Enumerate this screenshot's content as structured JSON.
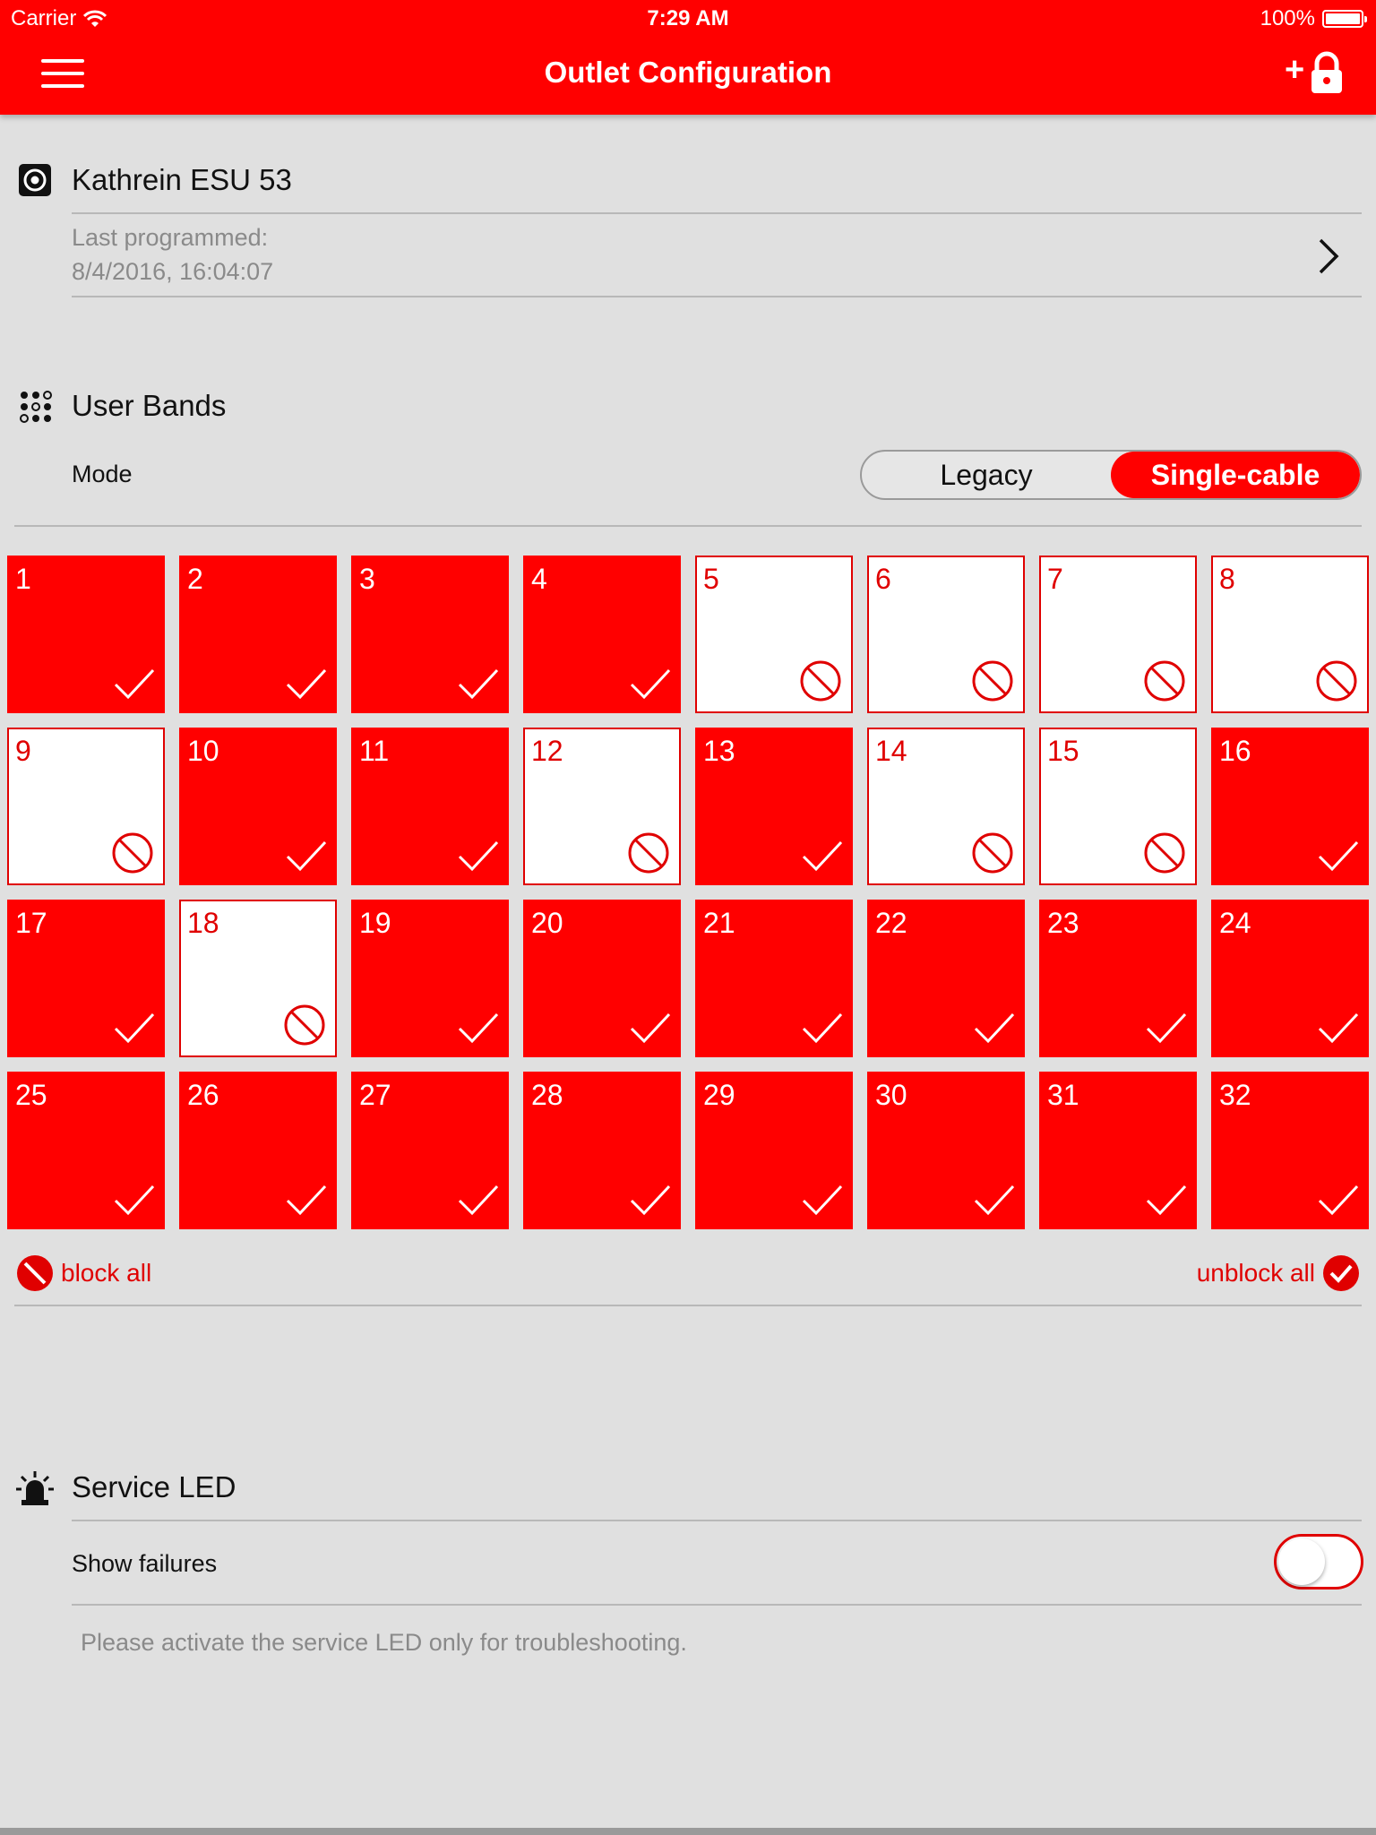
{
  "status_bar": {
    "carrier": "Carrier",
    "time": "7:29 AM",
    "battery": "100%"
  },
  "nav": {
    "title": "Outlet Configuration",
    "menu_icon": "hamburger-icon",
    "add_lock_icon": "add-lock-icon",
    "add_lock_plus": "+"
  },
  "device": {
    "name": "Kathrein ESU 53",
    "last_programmed_label": "Last programmed:",
    "last_programmed_value": "8/4/2016, 16:04:07"
  },
  "user_bands": {
    "title": "User Bands",
    "mode_label": "Mode",
    "modes": [
      "Legacy",
      "Single-cable"
    ],
    "selected_mode": "Single-cable",
    "bands": [
      {
        "number": "1",
        "enabled": true
      },
      {
        "number": "2",
        "enabled": true
      },
      {
        "number": "3",
        "enabled": true
      },
      {
        "number": "4",
        "enabled": true
      },
      {
        "number": "5",
        "enabled": false
      },
      {
        "number": "6",
        "enabled": false
      },
      {
        "number": "7",
        "enabled": false
      },
      {
        "number": "8",
        "enabled": false
      },
      {
        "number": "9",
        "enabled": false
      },
      {
        "number": "10",
        "enabled": true
      },
      {
        "number": "11",
        "enabled": true
      },
      {
        "number": "12",
        "enabled": false
      },
      {
        "number": "13",
        "enabled": true
      },
      {
        "number": "14",
        "enabled": false
      },
      {
        "number": "15",
        "enabled": false
      },
      {
        "number": "16",
        "enabled": true
      },
      {
        "number": "17",
        "enabled": true
      },
      {
        "number": "18",
        "enabled": false
      },
      {
        "number": "19",
        "enabled": true
      },
      {
        "number": "20",
        "enabled": true
      },
      {
        "number": "21",
        "enabled": true
      },
      {
        "number": "22",
        "enabled": true
      },
      {
        "number": "23",
        "enabled": true
      },
      {
        "number": "24",
        "enabled": true
      },
      {
        "number": "25",
        "enabled": true
      },
      {
        "number": "26",
        "enabled": true
      },
      {
        "number": "27",
        "enabled": true
      },
      {
        "number": "28",
        "enabled": true
      },
      {
        "number": "29",
        "enabled": true
      },
      {
        "number": "30",
        "enabled": true
      },
      {
        "number": "31",
        "enabled": true
      },
      {
        "number": "32",
        "enabled": true
      }
    ],
    "block_all": "block all",
    "unblock_all": "unblock all"
  },
  "service_led": {
    "title": "Service LED",
    "show_failures_label": "Show failures",
    "show_failures_on": false,
    "note": "Please activate the service LED only for troubleshooting."
  },
  "colors": {
    "accent": "#ff0000",
    "background": "#e0e0e0"
  }
}
